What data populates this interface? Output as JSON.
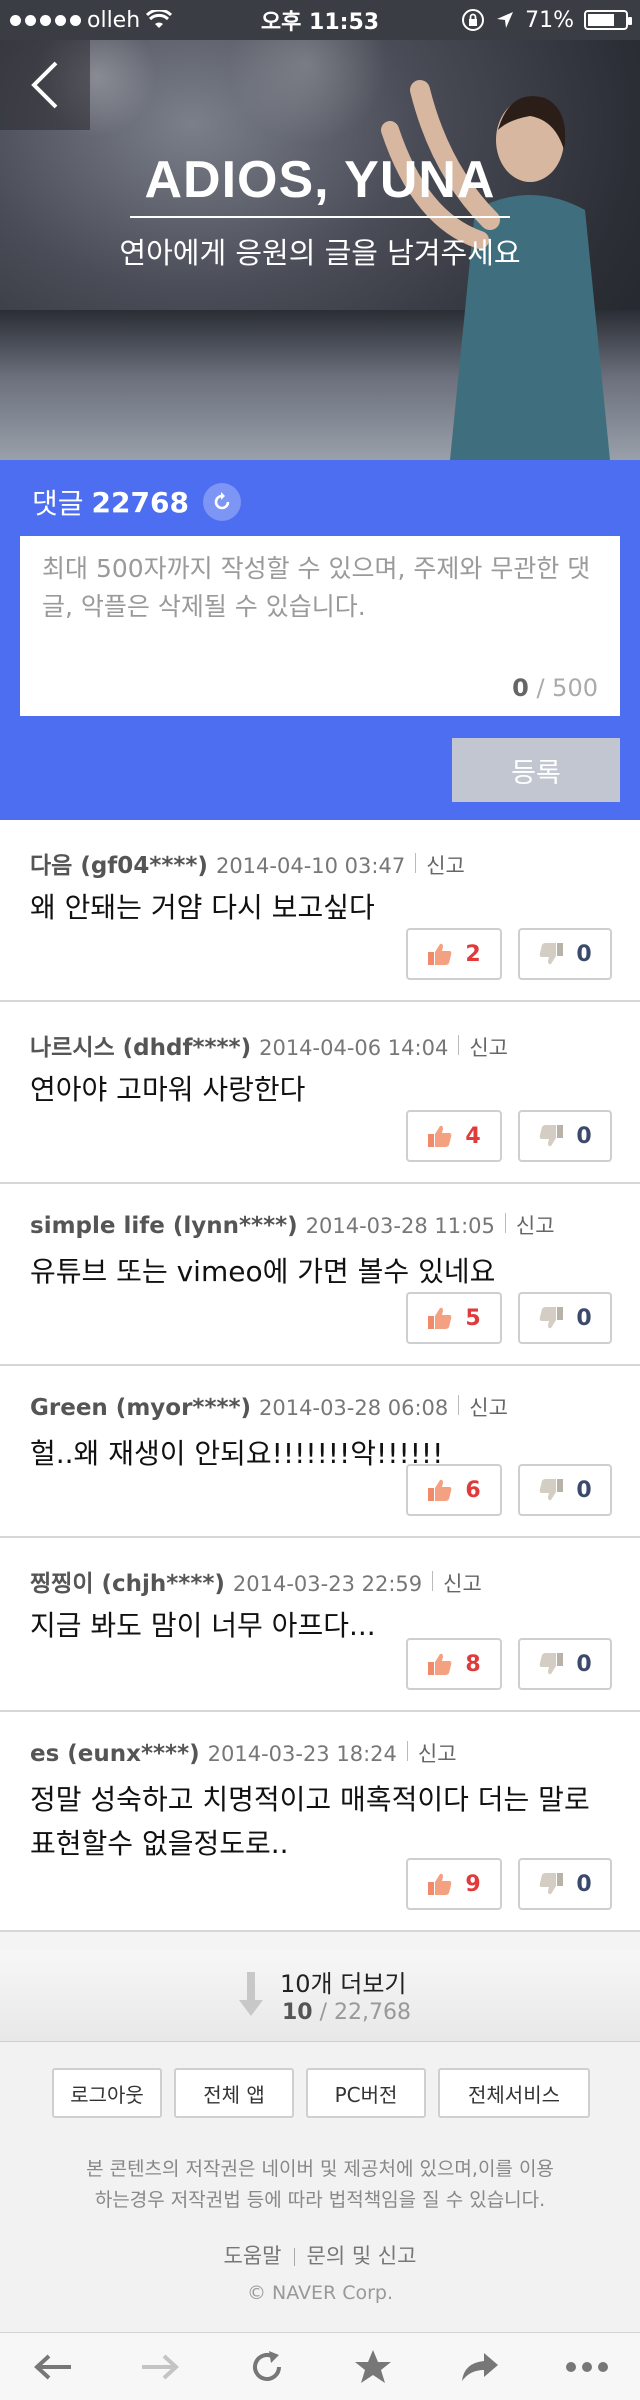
{
  "status_bar": {
    "carrier": "olleh",
    "time": "오후 11:53",
    "battery": "71%",
    "battery_level": 0.71
  },
  "hero": {
    "title": "ADIOS, YUNA",
    "subtitle": "연아에게 응원의 글을 남겨주세요"
  },
  "composer": {
    "label": "댓글",
    "total": "22768",
    "placeholder": "최대 500자까지 작성할 수 있으며, 주제와 무관한 댓글, 악플은 삭제될 수 있습니다.",
    "current_length": "0",
    "max_length": "/ 500",
    "submit_label": "등록"
  },
  "comments": [
    {
      "author": "다음 (gf04****)",
      "date": "2014-04-10 03:47",
      "report": "신고",
      "text": "왜 안돼는 거얌 다시 보고싶다",
      "likes": "2",
      "dislikes": "0"
    },
    {
      "author": "나르시스 (dhdf****)",
      "date": "2014-04-06 14:04",
      "report": "신고",
      "text": "연아야 고마워 사랑한다",
      "likes": "4",
      "dislikes": "0"
    },
    {
      "author": "simple life (lynn****)",
      "date": "2014-03-28 11:05",
      "report": "신고",
      "text": "유튜브 또는 vimeo에 가면 볼수 있네요",
      "likes": "5",
      "dislikes": "0"
    },
    {
      "author": "Green (myor****)",
      "date": "2014-03-28 06:08",
      "report": "신고",
      "text": "헐..왜 재생이 안되요!!!!!!!악!!!!!!",
      "likes": "6",
      "dislikes": "0"
    },
    {
      "author": "찡찡이 (chjh****)",
      "date": "2014-03-23 22:59",
      "report": "신고",
      "text": "지금 봐도 맘이 너무 아프다...",
      "likes": "8",
      "dislikes": "0"
    },
    {
      "author": "es (eunx****)",
      "date": "2014-03-23 18:24",
      "report": "신고",
      "text": "정말 성숙하고 치명적이고 매혹적이다 더는 말로 표현할수 없을정도로..",
      "likes": "9",
      "dislikes": "0"
    }
  ],
  "more": {
    "label": "10개 더보기",
    "shown": "10",
    "total": "/ 22,768"
  },
  "footer": {
    "buttons": [
      "로그아웃",
      "전체 앱",
      "PC버전",
      "전체서비스"
    ],
    "copyright_line1": "본 콘텐츠의 저작권은 네이버 및 제공처에 있으며,이를 이용",
    "copyright_line2": "하는경우 저작권법 등에 따라 법적책임을 질 수 있습니다.",
    "help": "도움말",
    "inquiry": "문의 및 신고",
    "corp": "© NAVER Corp."
  },
  "colors": {
    "composer_bg": "#4d6ef0",
    "like": "#e03a3a",
    "dislike": "#3b4a6b"
  }
}
